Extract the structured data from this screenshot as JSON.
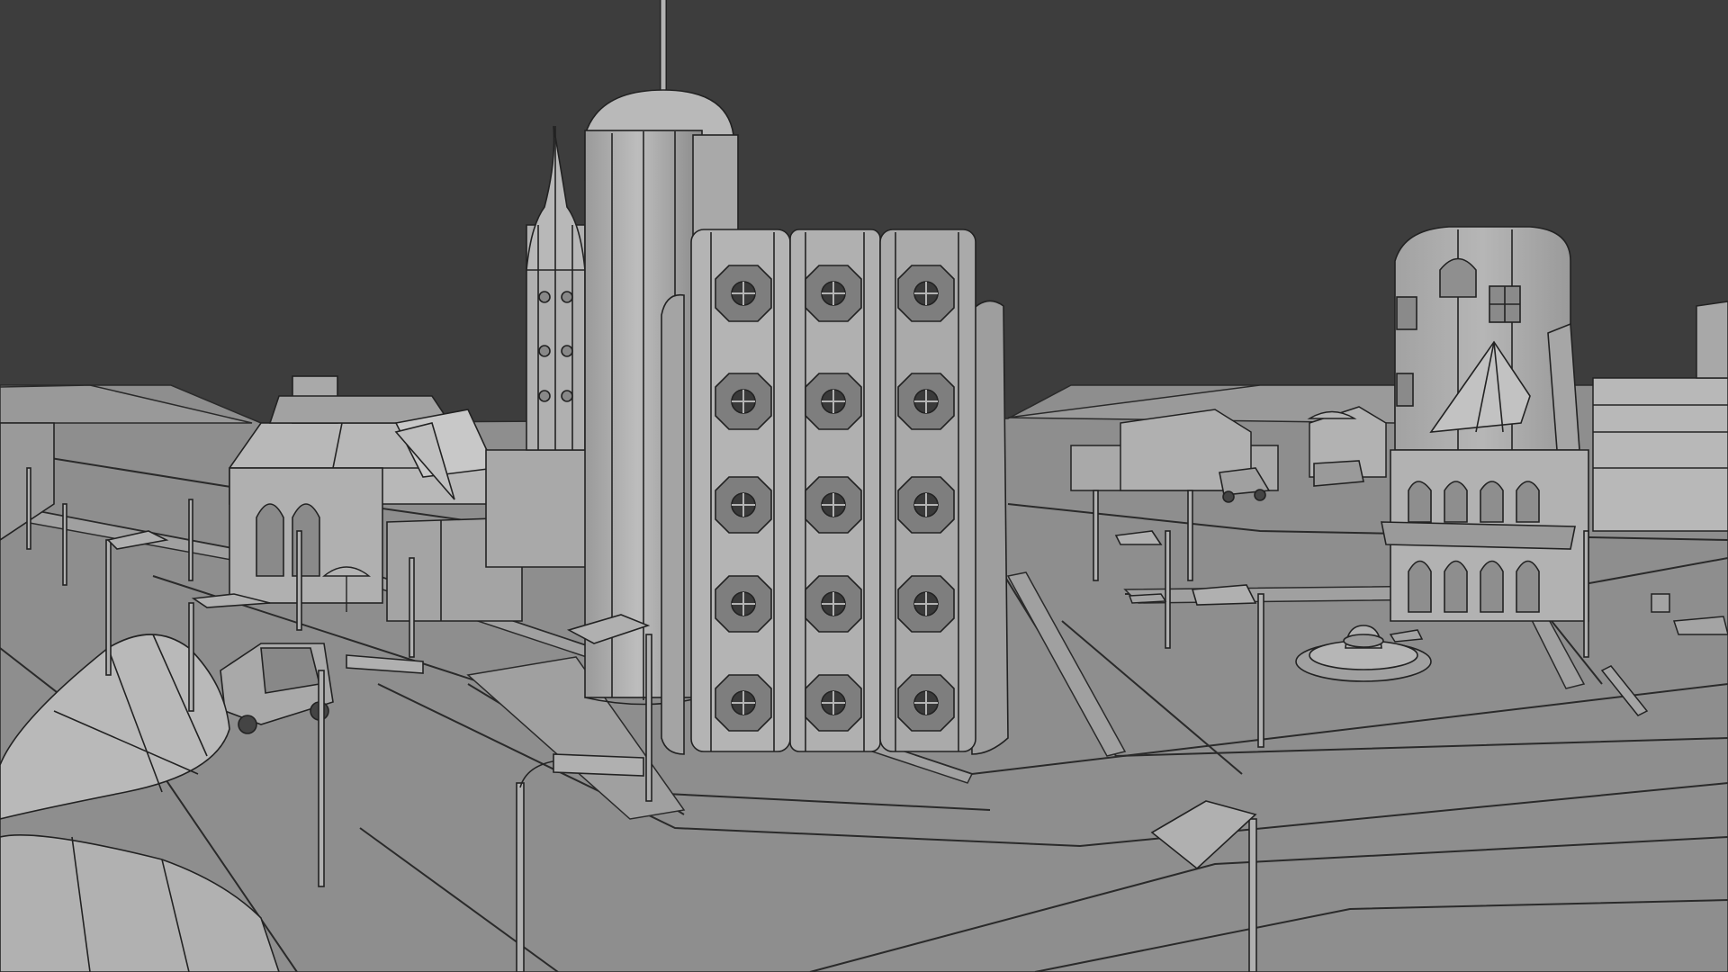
{
  "viewport": {
    "mode": "solid-wireframe",
    "colors": {
      "background": "#3d3d3d",
      "ground": "#8e8e8e",
      "surface_light": "#b4b4b4",
      "surface_mid": "#9d9d9d",
      "surface_dark": "#7c7c7c",
      "wire": "#222222"
    }
  },
  "scene": {
    "objects": [
      {
        "name": "hex-window-tower"
      },
      {
        "name": "domed-cylinder-tower"
      },
      {
        "name": "spire-tower"
      },
      {
        "name": "arched-building-right"
      },
      {
        "name": "pavilion-building-left"
      },
      {
        "name": "fountain"
      },
      {
        "name": "street-lamps"
      },
      {
        "name": "vehicles"
      },
      {
        "name": "benches"
      }
    ]
  }
}
